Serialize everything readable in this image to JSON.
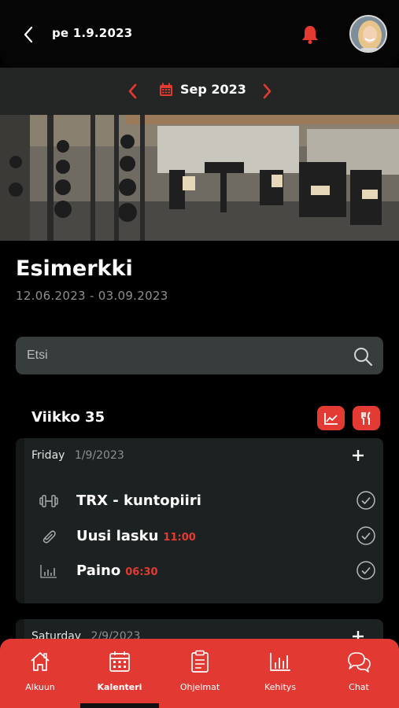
{
  "header": {
    "back_icon": "chevron-left-icon",
    "date": "pe 1.9.2023",
    "bell_icon": "bell-icon",
    "bell_color": "#e53a30"
  },
  "month_nav": {
    "label": "Sep 2023",
    "accent": "#e53a30"
  },
  "plan": {
    "title": "Esimerkki",
    "range": "12.06.2023 - 03.09.2023"
  },
  "search": {
    "placeholder": "Etsi"
  },
  "week": {
    "label": "Viikko 35",
    "chart_icon": "chart-icon",
    "meal_icon": "fork-knife-icon"
  },
  "days": [
    {
      "name": "Friday",
      "date": "1/9/2023",
      "entries": [
        {
          "icon": "dumbbell-icon",
          "title": "TRX - kuntopiiri",
          "time": ""
        },
        {
          "icon": "paperclip-icon",
          "title": "Uusi lasku",
          "time": "11:00"
        },
        {
          "icon": "bar-chart-icon",
          "title": "Paino",
          "time": "06:30"
        }
      ]
    },
    {
      "name": "Saturday",
      "date": "2/9/2023",
      "entries": []
    }
  ],
  "nav": [
    {
      "label": "Alkuun",
      "icon": "home-icon"
    },
    {
      "label": "Kalenteri",
      "icon": "calendar-icon",
      "active": true
    },
    {
      "label": "Ohjelmat",
      "icon": "clipboard-icon"
    },
    {
      "label": "Kehitys",
      "icon": "chart-icon"
    },
    {
      "label": "Chat",
      "icon": "chat-icon"
    }
  ],
  "colors": {
    "accent": "#e23a33",
    "card": "#1c2221",
    "search_bg": "#363d3c"
  }
}
